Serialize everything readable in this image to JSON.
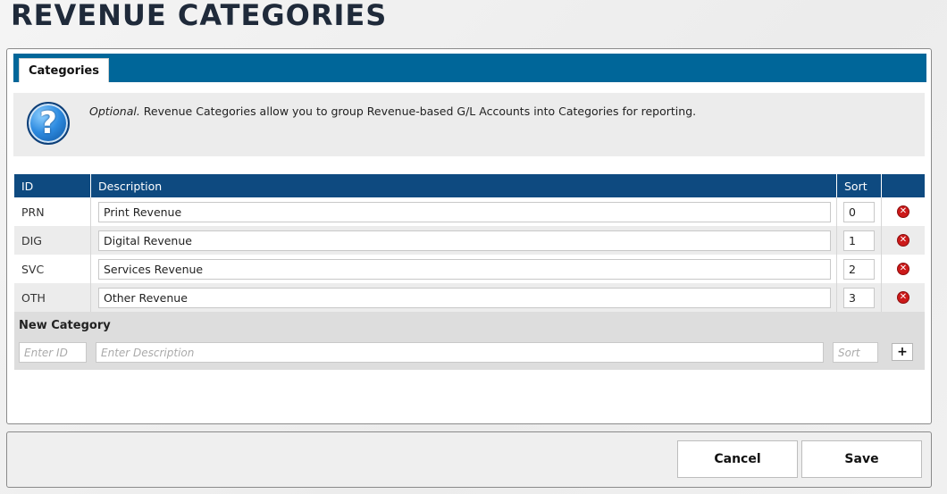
{
  "page": {
    "title": "REVENUE CATEGORIES"
  },
  "tabs": [
    {
      "label": "Categories",
      "active": true
    }
  ],
  "info": {
    "optional_label": "Optional.",
    "text": " Revenue Categories allow you to group Revenue-based G/L Accounts into Categories for reporting.",
    "icon": "help-question-icon"
  },
  "grid": {
    "columns": {
      "id": "ID",
      "description": "Description",
      "sort": "Sort"
    },
    "rows": [
      {
        "id": "PRN",
        "description": "Print Revenue",
        "sort": "0"
      },
      {
        "id": "DIG",
        "description": "Digital Revenue",
        "sort": "1"
      },
      {
        "id": "SVC",
        "description": "Services Revenue",
        "sort": "2"
      },
      {
        "id": "OTH",
        "description": "Other Revenue",
        "sort": "3"
      }
    ],
    "delete_icon": "delete-x-icon"
  },
  "new_category": {
    "title": "New Category",
    "id_placeholder": "Enter ID",
    "description_placeholder": "Enter Description",
    "sort_placeholder": "Sort",
    "add_label": "+"
  },
  "footer": {
    "cancel_label": "Cancel",
    "save_label": "Save"
  },
  "colors": {
    "tabbar": "#006699",
    "grid_header": "#0e4a80",
    "delete": "#cc1a1a"
  }
}
